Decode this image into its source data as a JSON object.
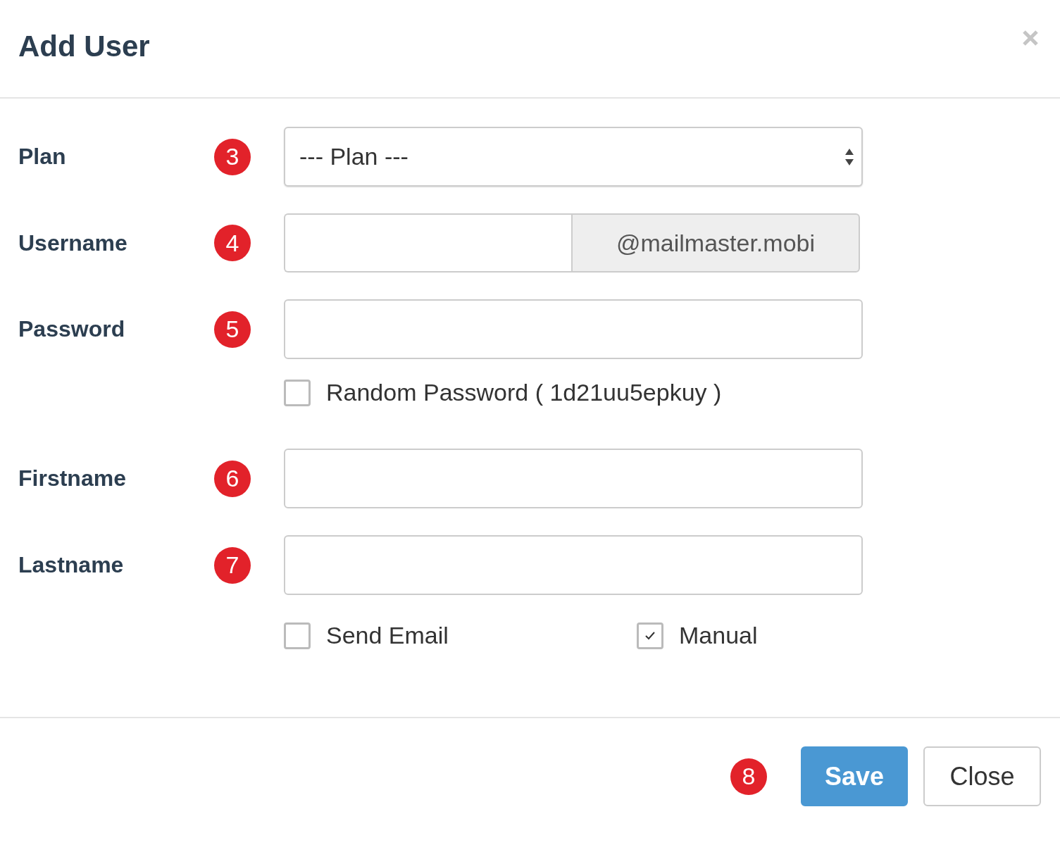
{
  "dialog": {
    "title": "Add User"
  },
  "fields": [
    {
      "kind": "select",
      "label": "Plan",
      "badge": "3",
      "value": "--- Plan ---"
    },
    {
      "kind": "addon",
      "label": "Username",
      "badge": "4",
      "addon": "@mailmaster.mobi"
    },
    {
      "kind": "text",
      "label": "Password",
      "badge": "5"
    },
    {
      "kind": "checks",
      "checks": [
        {
          "label": "Random Password ( 1d21uu5epkuy )",
          "checked": false
        }
      ]
    },
    {
      "kind": "text",
      "label": "Firstname",
      "badge": "6"
    },
    {
      "kind": "text",
      "label": "Lastname",
      "badge": "7"
    },
    {
      "kind": "checks",
      "checks": [
        {
          "label": "Send Email",
          "checked": false
        },
        {
          "label": "Manual",
          "checked": true
        }
      ]
    }
  ],
  "footer": {
    "badge": "8",
    "buttons": [
      {
        "label": "Save",
        "kind": "primary"
      },
      {
        "label": "Close",
        "kind": "default"
      }
    ]
  }
}
